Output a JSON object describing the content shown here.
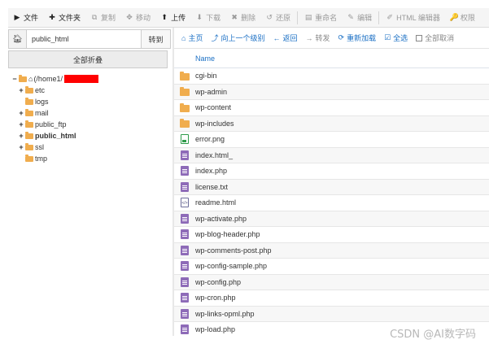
{
  "toolbar": {
    "items": [
      {
        "label": "文件",
        "icon": "▶",
        "active": true
      },
      {
        "label": "文件夹",
        "icon": "✚",
        "active": true
      },
      {
        "label": "复制",
        "icon": "⧉",
        "active": false
      },
      {
        "label": "移动",
        "icon": "✥",
        "active": false
      },
      {
        "label": "上传",
        "icon": "⬆",
        "active": true
      },
      {
        "label": "下载",
        "icon": "⬇",
        "active": false
      },
      {
        "label": "删除",
        "icon": "✖",
        "active": false
      },
      {
        "label": "还原",
        "icon": "↺",
        "active": false
      },
      {
        "label": "重命名",
        "icon": "▤",
        "active": false
      },
      {
        "label": "编辑",
        "icon": "✎",
        "active": false
      },
      {
        "label": "HTML 编辑器",
        "icon": "✐",
        "active": false
      },
      {
        "label": "权限",
        "icon": "🔑",
        "active": false
      }
    ]
  },
  "left": {
    "path_value": "public_html",
    "go_label": "转到",
    "collapse_label": "全部折叠",
    "tree": {
      "root_label": "(/home1/",
      "items": [
        {
          "label": "etc",
          "toggle": "+",
          "bold": false
        },
        {
          "label": "logs",
          "toggle": "",
          "bold": false
        },
        {
          "label": "mail",
          "toggle": "+",
          "bold": false
        },
        {
          "label": "public_ftp",
          "toggle": "+",
          "bold": false
        },
        {
          "label": "public_html",
          "toggle": "+",
          "bold": true
        },
        {
          "label": "ssl",
          "toggle": "+",
          "bold": false
        },
        {
          "label": "tmp",
          "toggle": "",
          "bold": false
        }
      ]
    }
  },
  "nav": {
    "home": "主页",
    "up": "向上一个级别",
    "back": "返回",
    "forward": "转发",
    "reload": "重新加载",
    "select_all": "全选",
    "deselect_all": "全部取消"
  },
  "table": {
    "header_name": "Name",
    "files": [
      {
        "name": "cgi-bin",
        "type": "folder"
      },
      {
        "name": "wp-admin",
        "type": "folder"
      },
      {
        "name": "wp-content",
        "type": "folder"
      },
      {
        "name": "wp-includes",
        "type": "folder"
      },
      {
        "name": "error.png",
        "type": "image"
      },
      {
        "name": "index.html_",
        "type": "doc"
      },
      {
        "name": "index.php",
        "type": "doc"
      },
      {
        "name": "license.txt",
        "type": "doc"
      },
      {
        "name": "readme.html",
        "type": "html"
      },
      {
        "name": "wp-activate.php",
        "type": "doc"
      },
      {
        "name": "wp-blog-header.php",
        "type": "doc"
      },
      {
        "name": "wp-comments-post.php",
        "type": "doc"
      },
      {
        "name": "wp-config-sample.php",
        "type": "doc"
      },
      {
        "name": "wp-config.php",
        "type": "doc"
      },
      {
        "name": "wp-cron.php",
        "type": "doc"
      },
      {
        "name": "wp-links-opml.php",
        "type": "doc"
      },
      {
        "name": "wp-load.php",
        "type": "doc"
      }
    ]
  },
  "watermark": "CSDN @AI数字码",
  "colors": {
    "accent": "#1a6fc4",
    "folder": "#f0ad4e",
    "doc": "#8e6bb8",
    "image": "#2e9b4a",
    "redaction": "#ff0000"
  }
}
